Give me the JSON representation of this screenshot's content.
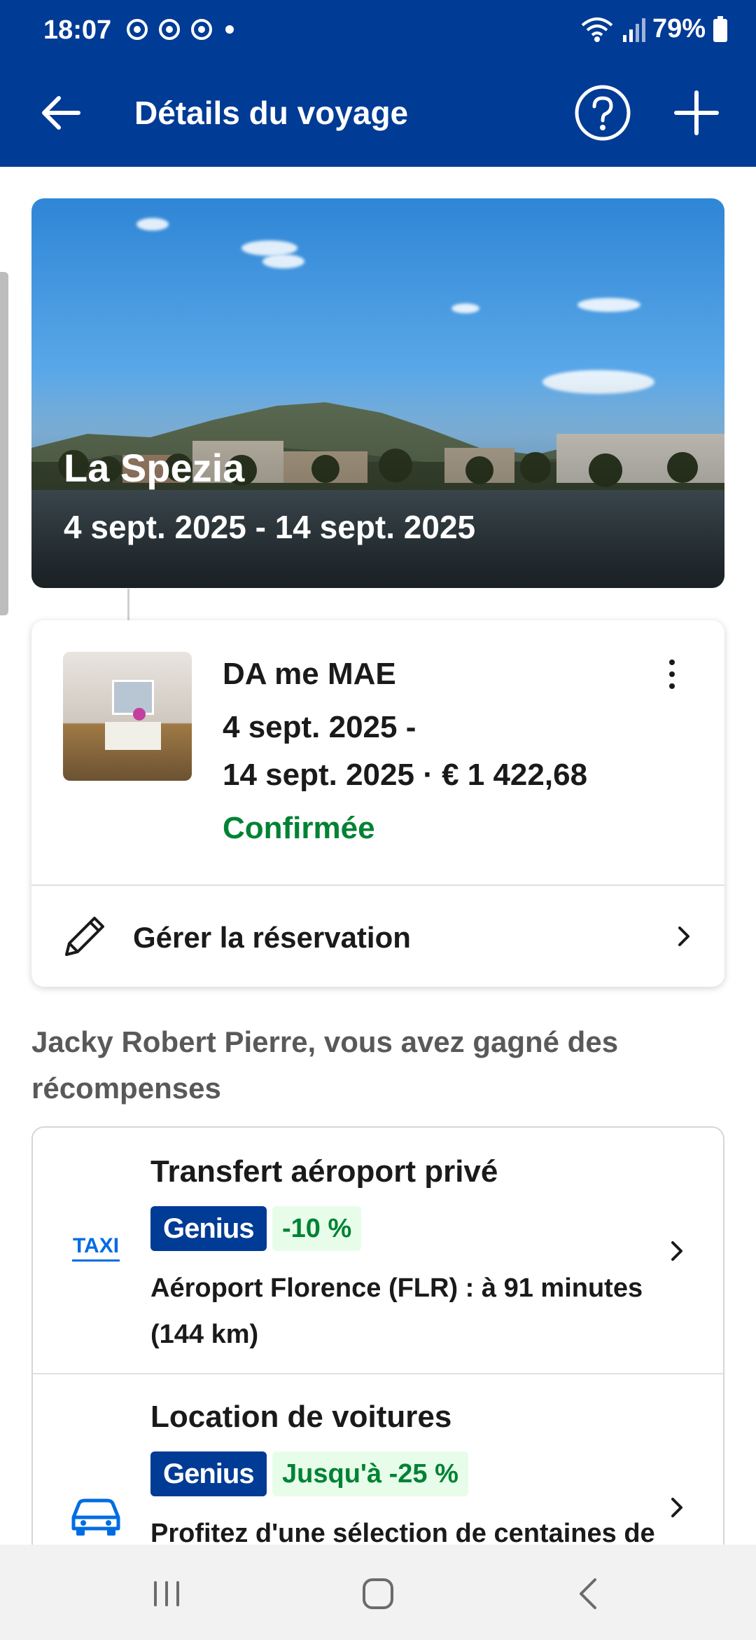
{
  "status_bar": {
    "time": "18:07",
    "battery": "79%",
    "notification_icons": [
      "chrome-icon",
      "chrome-icon",
      "chrome-icon",
      "dot-icon"
    ]
  },
  "app_bar": {
    "title": "Détails du voyage",
    "back_icon": "arrow-left-icon",
    "help_icon": "help-circle-icon",
    "add_icon": "plus-icon"
  },
  "trip": {
    "city": "La Spezia",
    "dates": "4 sept. 2025 - 14 sept. 2025"
  },
  "booking": {
    "name": "DA me MAE",
    "dates_line1": "4 sept. 2025 -",
    "dates_line2": "14 sept. 2025 · € 1 422,68",
    "status": "Confirmée",
    "manage_label": "Gérer la réservation"
  },
  "rewards": {
    "heading": "Jacky Robert Pierre, vous avez gagné des récompenses",
    "items": [
      {
        "title": "Transfert aéroport privé",
        "badge": "Genius",
        "discount": "-10 %",
        "description": "Aéroport Florence (FLR) : à 91 minutes (144 km)",
        "icon": "taxi-icon",
        "icon_label": "TAXI"
      },
      {
        "title": "Location de voitures",
        "badge": "Genius",
        "discount": "Jusqu'à -25 %",
        "description": "Profitez d'une sélection de centaines de",
        "icon": "car-icon"
      }
    ]
  },
  "colors": {
    "brand_blue": "#003b95",
    "confirm_green": "#008234",
    "discount_bg": "#e7fde9"
  }
}
